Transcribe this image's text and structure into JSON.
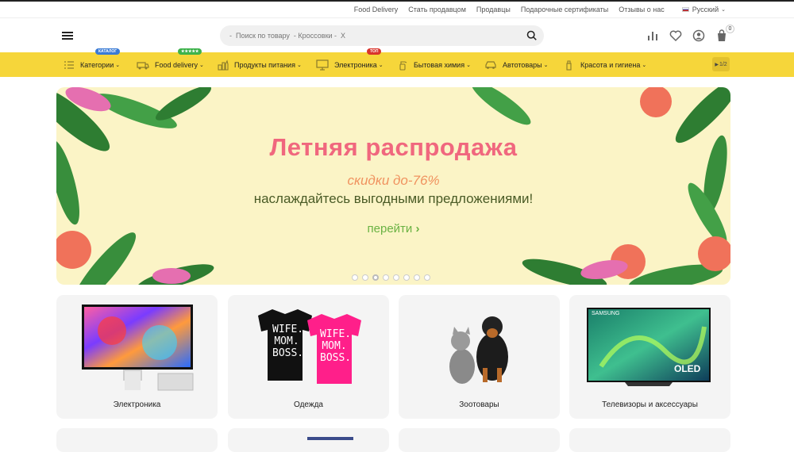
{
  "topbar": {
    "links": [
      "Food Delivery",
      "Стать продавцом",
      "Продавцы",
      "Подарочные сертификаты",
      "Отзывы о нас"
    ],
    "language": "Русский"
  },
  "header": {
    "search_placeholder": "-  Поиск по товару  - Кроссовки -  X",
    "cart_count": "0"
  },
  "categories": [
    {
      "label": "Категории",
      "badge": "КАТАЛОГ",
      "badge_color": "#3a7bd5"
    },
    {
      "label": "Food delivery",
      "badge": "★★★★★",
      "badge_color": "#3db24b"
    },
    {
      "label": "Продукты питания",
      "badge": "",
      "badge_color": ""
    },
    {
      "label": "Электроника",
      "badge": "ТОП",
      "badge_color": "#d9342b"
    },
    {
      "label": "Бытовая химия",
      "badge": "",
      "badge_color": ""
    },
    {
      "label": "Автотовары",
      "badge": "",
      "badge_color": ""
    },
    {
      "label": "Красота и гигиена",
      "badge": "",
      "badge_color": ""
    }
  ],
  "catbar_pager": "1/2",
  "banner": {
    "title": "Летняя распродажа",
    "subtitle": "скидки до-76%",
    "text": "наслаждайтесь выгодными предложениями!",
    "cta": "перейти",
    "slides": 8,
    "active_slide": 3
  },
  "cards": [
    {
      "label": "Электроника"
    },
    {
      "label": "Одежда"
    },
    {
      "label": "Зоотовары"
    },
    {
      "label": "Телевизоры и аксессуары"
    }
  ],
  "product_text": {
    "tshirt_text": "WIFE. MOM. BOSS.",
    "tv_brand": "SAMSUNG",
    "tv_logo": "OLED"
  },
  "colors": {
    "accent_yellow": "#f6d63a",
    "banner_bg": "#fbf4c6",
    "title_pink": "#f0677e",
    "cta_green": "#6ab243"
  }
}
